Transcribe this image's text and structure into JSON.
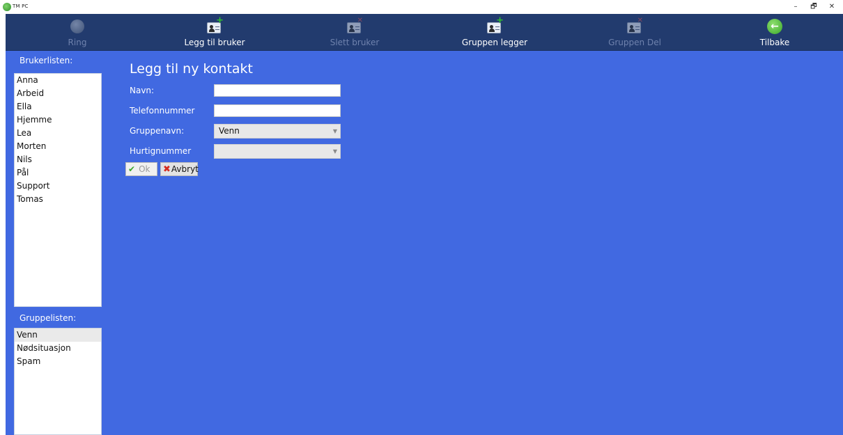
{
  "window": {
    "title": "TM PC",
    "minimize": "–",
    "restore": "🗗",
    "close": "✕"
  },
  "toolbar": {
    "items": [
      {
        "label": "Ring",
        "icon": "phone-globe-icon",
        "enabled": false
      },
      {
        "label": "Legg til bruker",
        "icon": "add-contact-icon",
        "enabled": true
      },
      {
        "label": "Slett bruker",
        "icon": "delete-contact-icon",
        "enabled": false
      },
      {
        "label": "Gruppen legger",
        "icon": "add-group-icon",
        "enabled": true
      },
      {
        "label": "Gruppen Del",
        "icon": "delete-group-icon",
        "enabled": false
      },
      {
        "label": "Tilbake",
        "icon": "back-arrow-icon",
        "enabled": true
      }
    ]
  },
  "userlist": {
    "label": "Brukerlisten:",
    "items": [
      "Anna",
      "Arbeid",
      "Ella",
      "Hjemme",
      "Lea",
      "Morten",
      "Nils",
      "Pål",
      "Support",
      "Tomas"
    ]
  },
  "grouplist": {
    "label": "Gruppelisten:",
    "items": [
      "Venn",
      "Nødsituasjon",
      "Spam"
    ],
    "selected": "Venn"
  },
  "form": {
    "title": "Legg til ny kontakt",
    "name_label": "Navn:",
    "name_value": "",
    "phone_label": "Telefonnummer",
    "phone_value": "",
    "group_label": "Gruppenavn:",
    "group_value": "Venn",
    "speed_label": "Hurtignummer",
    "speed_value": "",
    "ok_label": "Ok",
    "cancel_label": "Avbryt"
  },
  "colors": {
    "background": "#4169e1",
    "toolbar": "#223b6e",
    "accent_green": "#3aa62a",
    "accent_red": "#d42a1e"
  }
}
